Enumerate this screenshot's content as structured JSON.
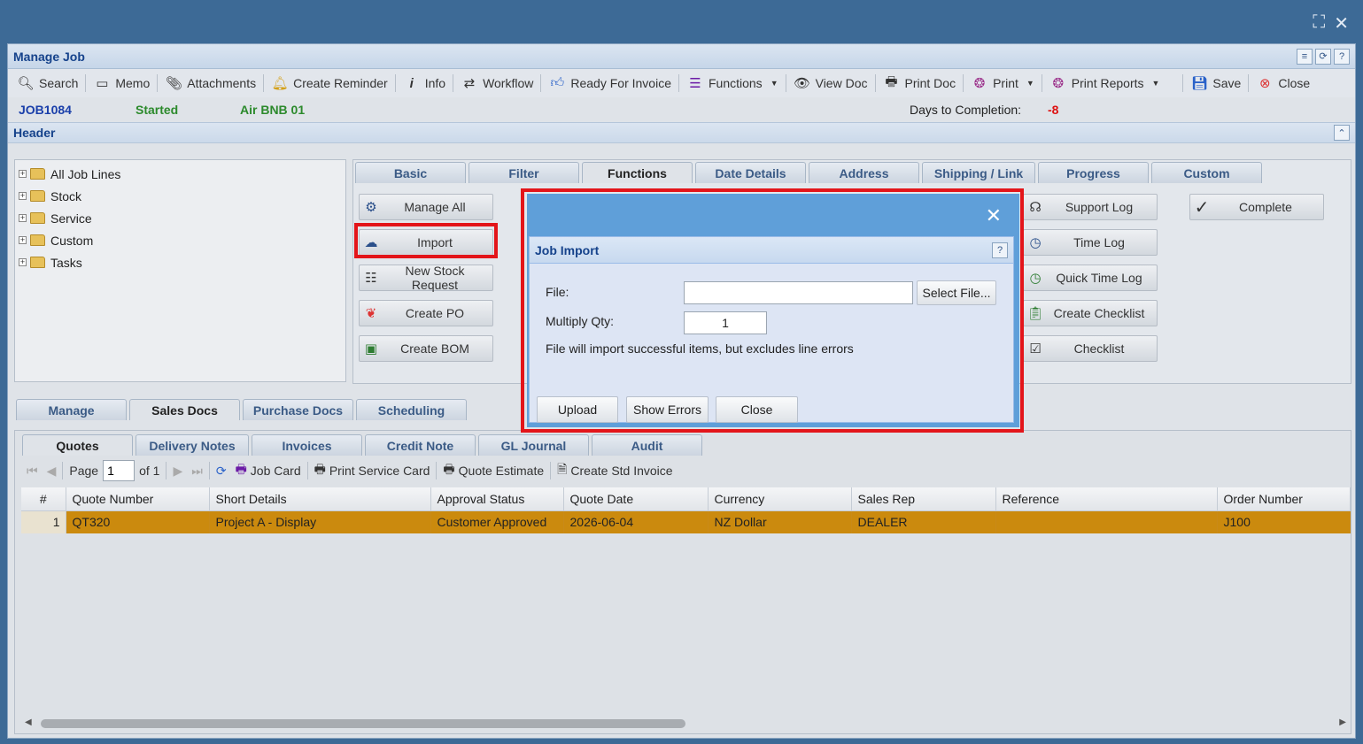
{
  "window": {
    "title": "Manage Job"
  },
  "toolbar": {
    "items": [
      {
        "label": "Search",
        "icon": "search-icon"
      },
      {
        "label": "Memo",
        "icon": "memo-icon"
      },
      {
        "label": "Attachments",
        "icon": "paperclip-icon"
      },
      {
        "label": "Create Reminder",
        "icon": "bell-icon"
      },
      {
        "label": "Info",
        "icon": "info-icon"
      },
      {
        "label": "Workflow",
        "icon": "workflow-icon"
      },
      {
        "label": "Ready For Invoice",
        "icon": "thumbs-up-icon"
      },
      {
        "label": "Functions",
        "icon": "menu-lines-icon"
      },
      {
        "label": "View Doc",
        "icon": "eye-icon"
      },
      {
        "label": "Print Doc",
        "icon": "printer-icon"
      },
      {
        "label": "Print",
        "icon": "print-badge-icon"
      },
      {
        "label": "Print Reports",
        "icon": "print-badge-icon"
      },
      {
        "label": "Save",
        "icon": "floppy-icon"
      },
      {
        "label": "Close",
        "icon": "close-circle-icon"
      }
    ]
  },
  "job": {
    "number": "JOB1084",
    "status": "Started",
    "name": "Air BNB 01",
    "days_label": "Days to Completion:",
    "days_value": "-8"
  },
  "header": {
    "title": "Header"
  },
  "tree": {
    "items": [
      "All Job Lines",
      "Stock",
      "Service",
      "Custom",
      "Tasks"
    ]
  },
  "tabs": [
    "Basic",
    "Filter",
    "Functions",
    "Date Details",
    "Address",
    "Shipping / Link",
    "Progress",
    "Custom"
  ],
  "functions": {
    "left": [
      "Manage All",
      "Import",
      "New Stock Request",
      "Create PO",
      "Create BOM"
    ],
    "right": [
      "Support Log",
      "Time Log",
      "Quick Time Log",
      "Create Checklist",
      "Checklist"
    ],
    "far": [
      "Complete"
    ]
  },
  "lower_tabs": [
    "Manage",
    "Sales Docs",
    "Purchase Docs",
    "Scheduling"
  ],
  "sub_tabs": [
    "Quotes",
    "Delivery Notes",
    "Invoices",
    "Credit Note",
    "GL Journal",
    "Audit"
  ],
  "pager": {
    "page_label": "Page",
    "page_value": "1",
    "of_label": "of 1",
    "actions": [
      "Job Card",
      "Print Service Card",
      "Quote Estimate",
      "Create Std Invoice"
    ]
  },
  "grid": {
    "columns": [
      "#",
      "Quote Number",
      "Short Details",
      "Approval Status",
      "Quote Date",
      "Currency",
      "Sales Rep",
      "Reference",
      "Order Number"
    ],
    "rows": [
      [
        "1",
        "QT320",
        "Project A - Display",
        "Customer Approved",
        "2026-06-04",
        "NZ Dollar",
        "DEALER",
        "",
        "J100"
      ]
    ]
  },
  "dialog": {
    "title": "Job Import",
    "file_label": "File:",
    "file_value": "",
    "select_file": "Select File...",
    "multiply_label": "Multiply Qty:",
    "multiply_value": "1",
    "note": "File will import successful items, but excludes line errors",
    "buttons": [
      "Upload",
      "Show Errors",
      "Close"
    ]
  }
}
